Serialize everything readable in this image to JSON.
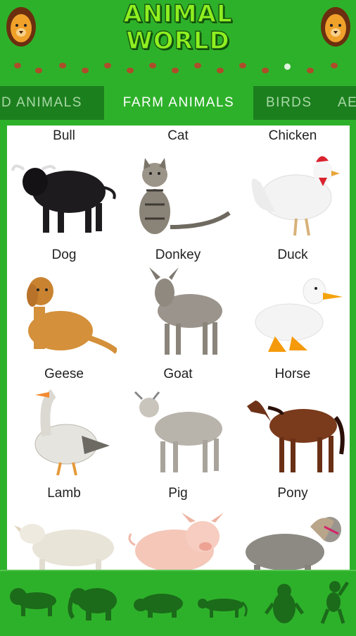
{
  "header": {
    "title_line1": "ANIMAL",
    "title_line2": "WORLD",
    "left_icon": "lion-face-icon",
    "right_icon": "lion-face-icon",
    "paw_color": "#c33b2a"
  },
  "tabs": [
    {
      "label": "D ANIMALS",
      "active": false
    },
    {
      "label": "FARM ANIMALS",
      "active": true
    },
    {
      "label": "BIRDS",
      "active": false
    },
    {
      "label": "AE",
      "active": false
    }
  ],
  "animals": [
    {
      "label": "Bull"
    },
    {
      "label": "Cat"
    },
    {
      "label": "Chicken"
    },
    {
      "label": "Dog"
    },
    {
      "label": "Donkey"
    },
    {
      "label": "Duck"
    },
    {
      "label": "Geese"
    },
    {
      "label": "Goat"
    },
    {
      "label": "Horse"
    },
    {
      "label": "Lamb"
    },
    {
      "label": "Pig"
    },
    {
      "label": "Pony"
    }
  ],
  "bottom_nav": [
    "lion-silhouette-icon",
    "elephant-silhouette-icon",
    "hippo-silhouette-icon",
    "leopard-silhouette-icon",
    "penguin-silhouette-icon",
    "monkey-silhouette-icon"
  ],
  "colors": {
    "app_green": "#2eb12a",
    "tab_bar": "#1c7f1e",
    "title_fill": "#8ff020"
  }
}
